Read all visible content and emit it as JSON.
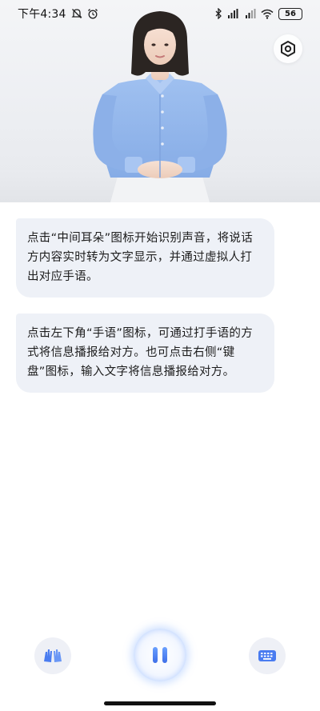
{
  "status_bar": {
    "time": "下午4:34",
    "battery_level": "56",
    "icons": [
      "mute-icon",
      "alarm-icon",
      "bluetooth-icon",
      "signal-hd-icon",
      "signal-icon",
      "wifi-icon",
      "battery-icon"
    ]
  },
  "header": {
    "settings_icon": "hexagon-settings-icon"
  },
  "messages": [
    {
      "text": "点击“中间耳朵”图标开始识别声音，将说话方内容实时转为文字显示，并通过虚拟人打出对应手语。"
    },
    {
      "text": "点击左下角“手语”图标，可通过打手语的方式将信息播报给对方。也可点击右侧“键盘”图标，输入文字将信息播报给对方。"
    }
  ],
  "bottom_bar": {
    "left_icon": "sign-language-hands-icon",
    "center_icon": "pause-icon",
    "right_icon": "keyboard-icon",
    "accent_color": "#3f6fe8"
  },
  "colors": {
    "bubble_bg": "#eef1f7",
    "shirt": "#8fb4ea",
    "accent": "#4a7cf0"
  }
}
